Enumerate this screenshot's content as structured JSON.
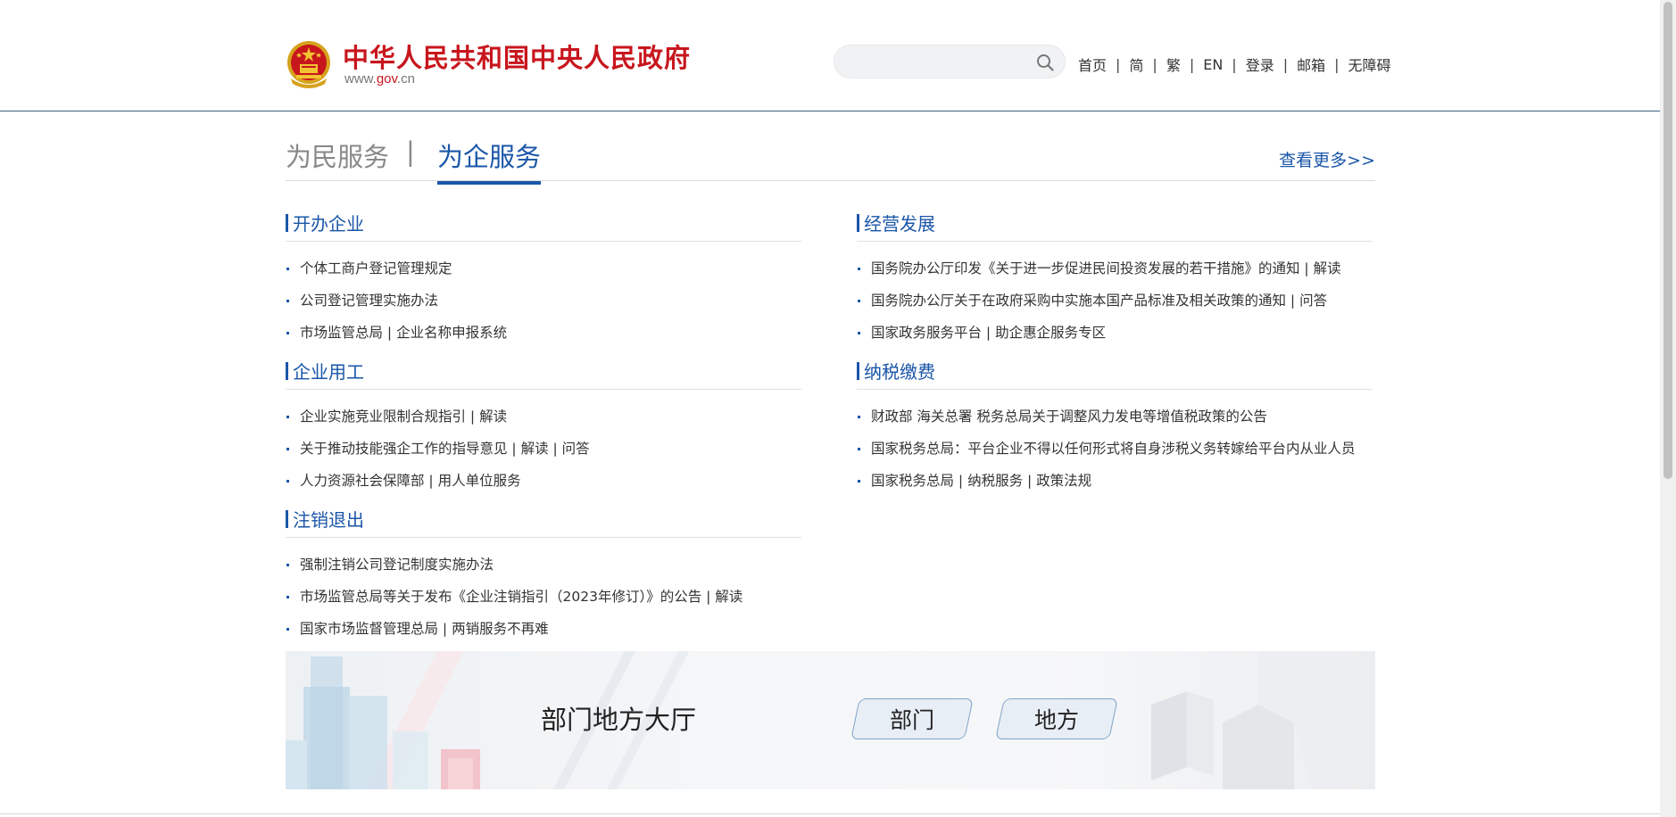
{
  "header": {
    "title": "中华人民共和国中央人民政府",
    "url_prefix": "www.",
    "url_highlight": "gov",
    "url_suffix": ".cn",
    "search": {
      "value": "",
      "placeholder": ""
    },
    "nav": [
      "首页",
      "简",
      "繁",
      "EN",
      "登录",
      "邮箱",
      "无障碍"
    ],
    "nav_separator": "|"
  },
  "tabs": {
    "items": [
      "为民服务",
      "为企服务"
    ],
    "divider": "|",
    "active": "为企服务",
    "more": "查看更多>>"
  },
  "left_column": [
    {
      "title": "开办企业",
      "items": [
        "个体工商户登记管理规定",
        "公司登记管理实施办法",
        "市场监管总局 | 企业名称申报系统"
      ]
    },
    {
      "title": "企业用工",
      "items": [
        "企业实施竞业限制合规指引 | 解读",
        "关于推动技能强企工作的指导意见 | 解读 | 问答",
        "人力资源社会保障部 | 用人单位服务"
      ]
    },
    {
      "title": "注销退出",
      "items": [
        "强制注销公司登记制度实施办法",
        "市场监管总局等关于发布《企业注销指引（2023年修订）》的公告 | 解读",
        "国家市场监督管理总局 | 两销服务不再难"
      ]
    }
  ],
  "right_column": [
    {
      "title": "经营发展",
      "items": [
        "国务院办公厅印发《关于进一步促进民间投资发展的若干措施》的通知 | 解读",
        "国务院办公厅关于在政府采购中实施本国产品标准及相关政策的通知 | 问答",
        "国家政务服务平台 | 助企惠企服务专区"
      ]
    },
    {
      "title": "纳税缴费",
      "items": [
        "财政部 海关总署 税务总局关于调整风力发电等增值税政策的公告",
        "国家税务总局：平台企业不得以任何形式将自身涉税义务转嫁给平台内从业人员",
        "国家税务总局 | 纳税服务 | 政策法规"
      ]
    }
  ],
  "banner": {
    "title": "部门地方大厅",
    "buttons": [
      "部门",
      "地方"
    ]
  },
  "colors": {
    "brand_red": "#c8161d",
    "link_blue": "#1a56a8",
    "header_line": "#3b5f86"
  }
}
